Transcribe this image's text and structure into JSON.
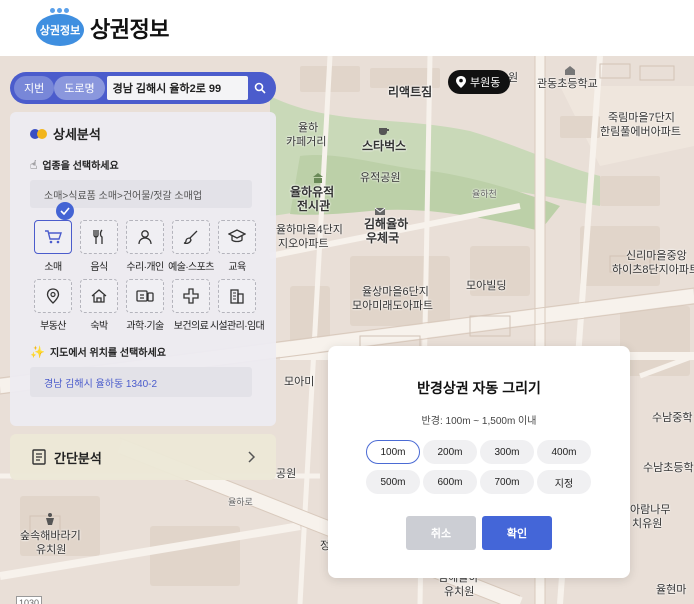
{
  "header": {
    "brand": "상권정보",
    "logo_text": "상권정보"
  },
  "search": {
    "tab_lot": "지번",
    "tab_road": "도로명",
    "value": "경남 김해시 율하2로 99"
  },
  "location_pill": "부원동",
  "panel": {
    "title": "상세분석",
    "step1": "업종을 선택하세요",
    "category_path": "소매>식료품 소매>건어물/젓갈 소매업",
    "categories": [
      {
        "label": "소매",
        "icon": "cart-icon"
      },
      {
        "label": "음식",
        "icon": "utensils-icon"
      },
      {
        "label": "수리·개인",
        "icon": "person-icon"
      },
      {
        "label": "예술·스포츠",
        "icon": "brush-icon"
      },
      {
        "label": "교육",
        "icon": "graduation-cap-icon"
      },
      {
        "label": "부동산",
        "icon": "map-pin-icon"
      },
      {
        "label": "숙박",
        "icon": "house-icon"
      },
      {
        "label": "과학·기술",
        "icon": "device-icon"
      },
      {
        "label": "보건의료",
        "icon": "cross-icon"
      },
      {
        "label": "시설관리·임대",
        "icon": "building-icon"
      }
    ],
    "step2": "지도에서 위치를 선택하세요",
    "address": "경남 김해시 율하동 1340-2"
  },
  "simple": {
    "label": "간단분석"
  },
  "modal": {
    "title": "반경상권 자동 그리기",
    "subtitle": "반경: 100m ~ 1,500m 이내",
    "options": [
      "100m",
      "200m",
      "300m",
      "400m",
      "500m",
      "600m",
      "700m",
      "지정"
    ],
    "selected": "100m",
    "cancel": "취소",
    "confirm": "확인"
  },
  "map_labels": {
    "l1": "리액트짐",
    "l2": "관동초등학교",
    "l3": "죽림마을7단지",
    "l4": "한림풀에버아파트",
    "l5": "율하",
    "l6": "카페거리",
    "l7": "스타벅스",
    "l8": "유적공원",
    "l9": "율하유적",
    "l10": "전시관",
    "l11": "율하천",
    "l12": "율하마을4단지",
    "l13": "지오아파트",
    "l14": "김해율하",
    "l15": "우체국",
    "l16": "신리마을중앙",
    "l17": "하이츠8단지아파트",
    "l18": "모아빌딩",
    "l19": "율상마을6단지",
    "l20": "모아미래도아파트",
    "l21": "수남중학",
    "l22": "수남초등학",
    "l23": "아람나무",
    "l24": "치유원",
    "l25": "숲속해바라기",
    "l26": "유치원",
    "l27": "율하로",
    "l28": "율현마",
    "l29": "김해율하",
    "l30": "유치원",
    "l31": "공원",
    "l32": "모아미",
    "l33": "1030",
    "l34": "원",
    "l35": "정"
  },
  "colors": {
    "accent": "#4b5ccc",
    "map_base": "#e9dfd7",
    "park": "#c5d6b6",
    "road": "#f7f3ee"
  }
}
